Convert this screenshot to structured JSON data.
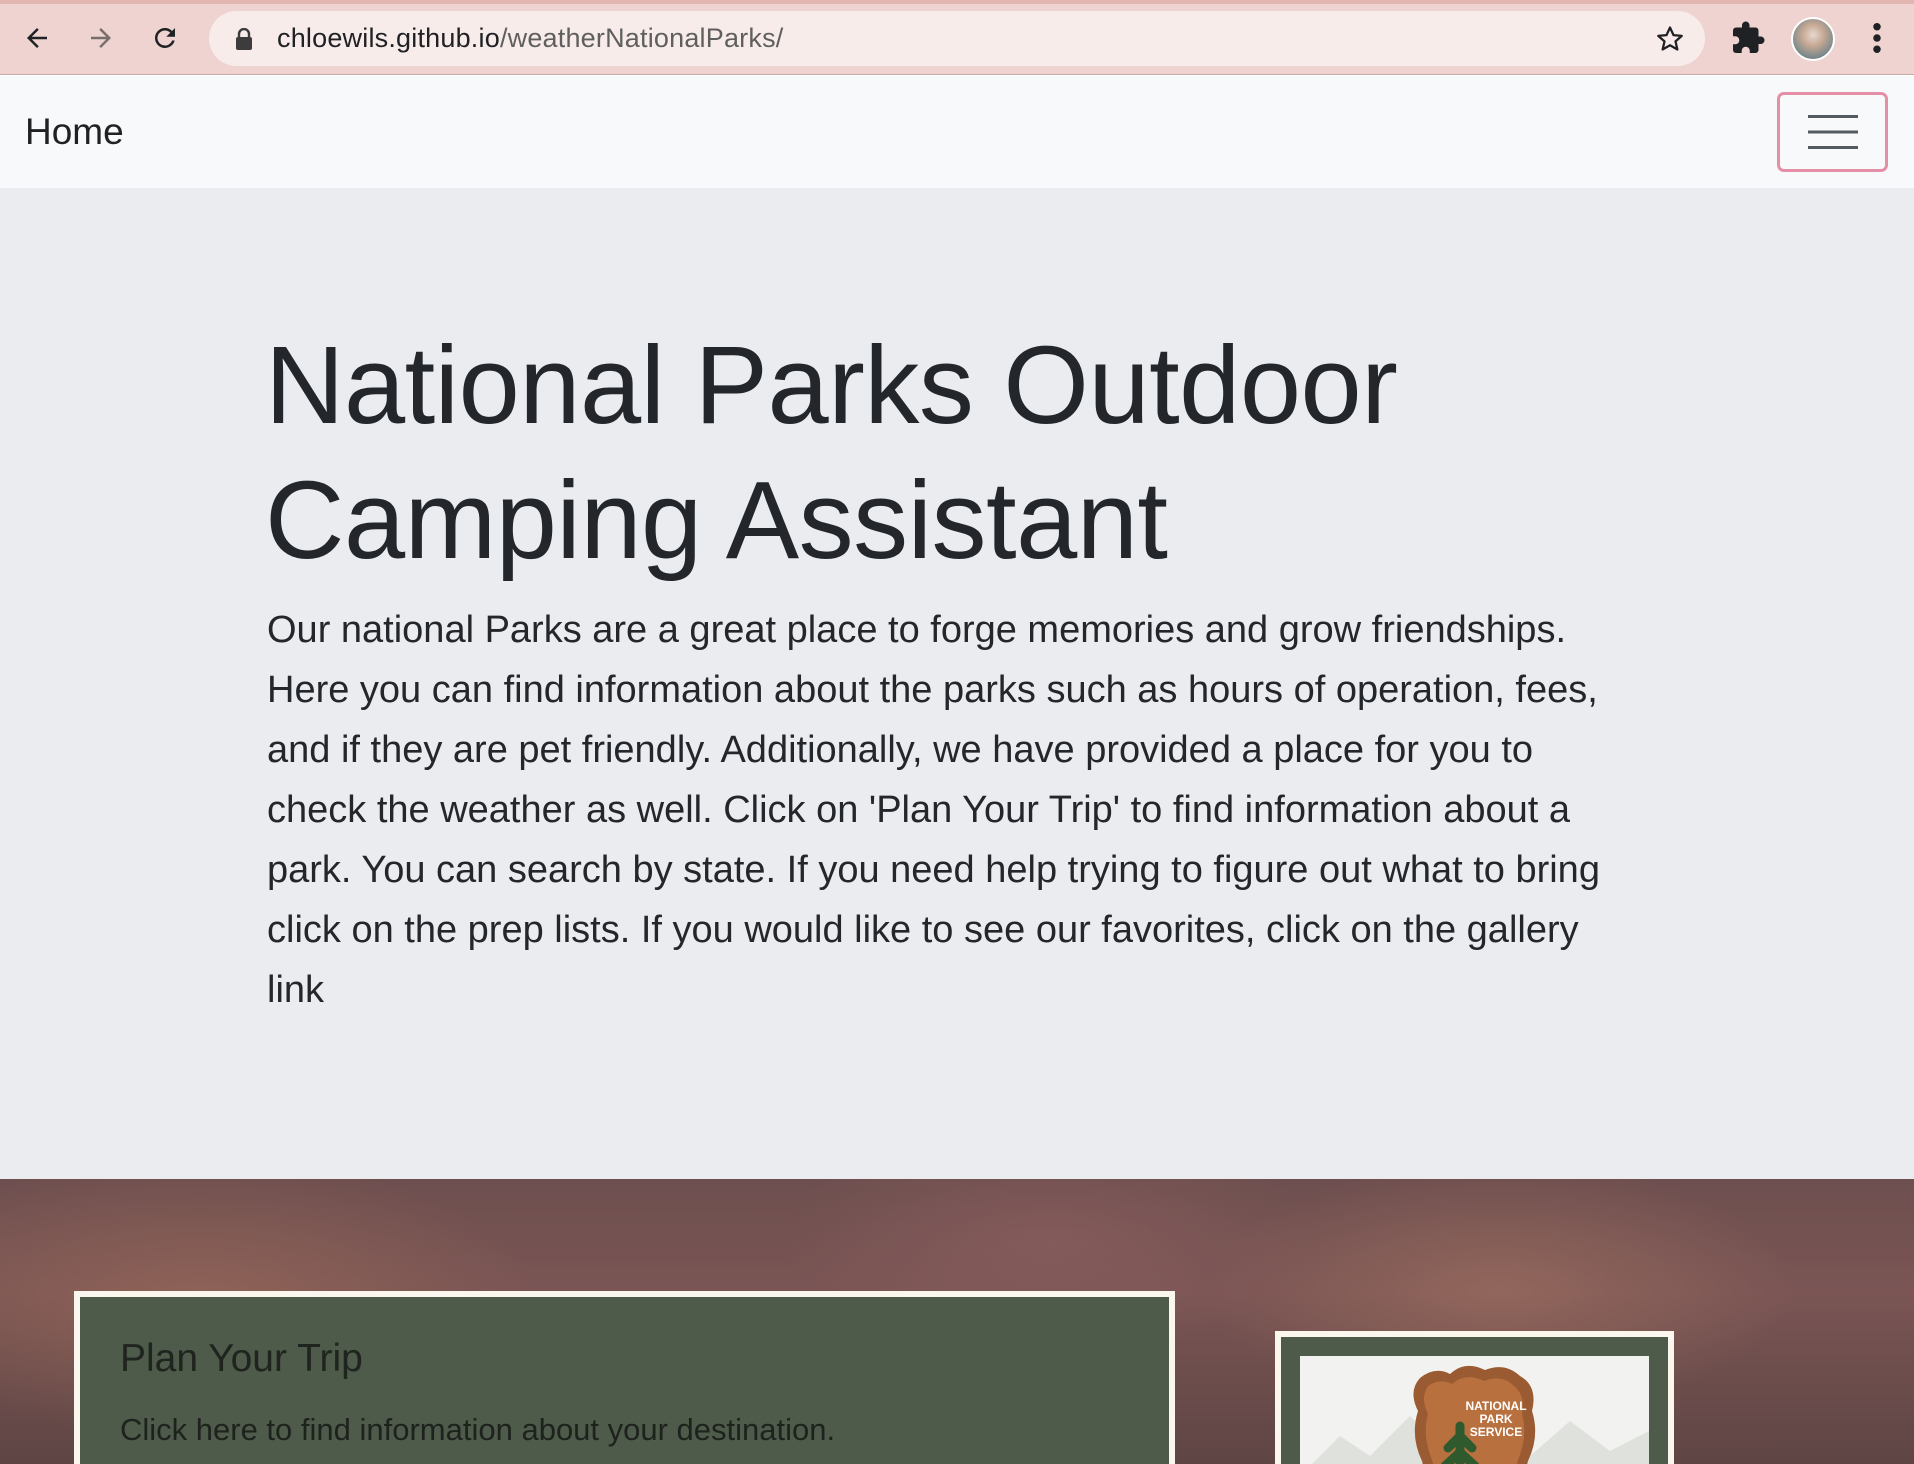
{
  "browser": {
    "url_host": "chloewils.github.io",
    "url_path": "/weatherNationalParks/",
    "icons": [
      "back-arrow-icon",
      "forward-arrow-icon",
      "reload-icon",
      "lock-icon",
      "star-icon",
      "extensions-puzzle-icon",
      "profile-avatar",
      "more-vert-icon"
    ]
  },
  "navbar": {
    "brand": "Home",
    "toggler_icon": "hamburger-icon",
    "toggler_border_color": "#e58fa6"
  },
  "hero": {
    "title": "National Parks Outdoor Camping Assistant",
    "text": "Our national Parks are a great place to forge memories and grow friendships. Here you can find information about the parks such as hours of operation, fees, and if they are pet friendly. Additionally, we have provided a place for you to check the weather as well. Click on 'Plan Your Trip' to find information about a park. You can search by state. If you need help trying to figure out what to bring click on the prep lists. If you would like to see our favorites, click on the gallery link",
    "background": "#ebecf0"
  },
  "cards": {
    "plan": {
      "title": "Plan Your Trip",
      "text": "Click here to find information about your destination.",
      "background": "#4e5a4a"
    },
    "logo": {
      "logo_text_line1": "NATIONAL",
      "logo_text_line2": "PARK",
      "logo_text_line3": "SERVICE"
    }
  }
}
